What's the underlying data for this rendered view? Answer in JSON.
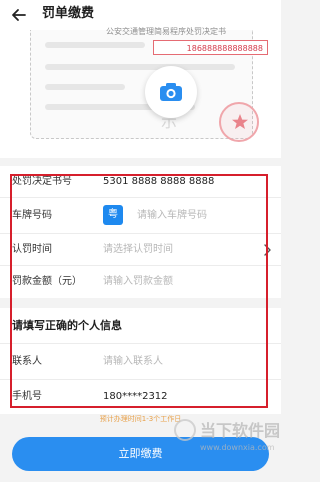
{
  "header": {
    "title": "罚单缴费"
  },
  "sample": {
    "doc_header": "公安交通管理简易程序处罚决定书",
    "penalty_no": "186888888888888",
    "watermark": "示"
  },
  "form": {
    "rows": [
      {
        "label": "处罚决定书号",
        "value": "5301 8888 8888 8888"
      },
      {
        "label": "车牌号码",
        "province": "粤",
        "placeholder": "请输入车牌号码"
      },
      {
        "label": "认罚时间",
        "placeholder": "请选择认罚时间"
      },
      {
        "label": "罚款金额（元）",
        "placeholder": "请输入罚款金额"
      }
    ],
    "personal_section_title": "请填写正确的个人信息",
    "contact": {
      "label": "联系人",
      "placeholder": "请输入联系人"
    },
    "phone": {
      "label": "手机号",
      "value": "180****2312"
    }
  },
  "hint": "预计办理时间1-3个工作日",
  "pay_button": "立即缴费",
  "site_watermark": {
    "name": "当下软件园",
    "url": "www.downxia.com"
  },
  "colors": {
    "primary": "#2a8ef0",
    "highlight_border": "#d61f2c",
    "hint": "#e8a14a"
  },
  "icons": [
    "back-arrow-icon",
    "camera-icon",
    "star-stamp-icon",
    "chevron-right-icon"
  ]
}
